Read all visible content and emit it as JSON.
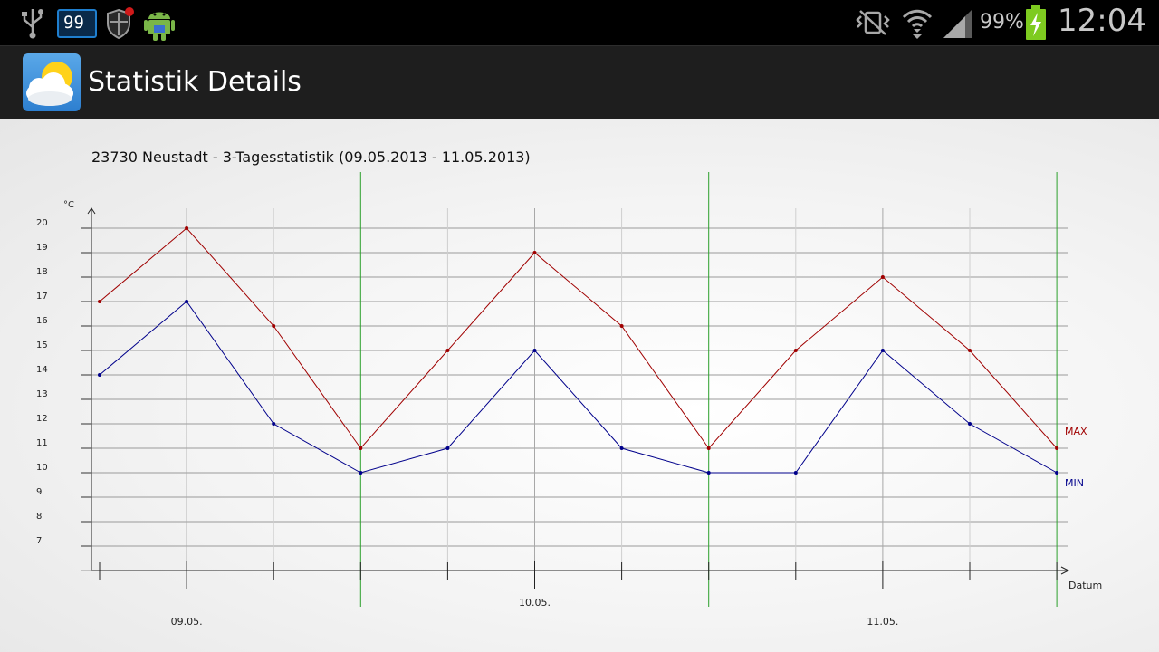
{
  "status_bar": {
    "notification_count": "99",
    "battery_percent": "99%",
    "clock": "12:04",
    "icons": [
      "usb-icon",
      "notification-count-icon",
      "shield-icon",
      "android-icon",
      "vibrate-off-icon",
      "wifi-icon",
      "signal-icon",
      "battery-charging-icon"
    ]
  },
  "action_bar": {
    "title": "Statistik Details",
    "app_icon": "weather-icon"
  },
  "chart_data": {
    "type": "line",
    "title": "23730 Neustadt - 3-Tagesstatistik (09.05.2013 - 11.05.2013)",
    "ylabel": "°C",
    "xlabel": "Datum",
    "ylim": [
      7,
      20
    ],
    "yticks": [
      "20",
      "19",
      "18",
      "17",
      "16",
      "15",
      "14",
      "13",
      "12",
      "11",
      "10",
      "9",
      "8",
      "7"
    ],
    "x_points": 12,
    "day_labels": [
      "09.05.",
      "10.05.",
      "11.05."
    ],
    "series": [
      {
        "name": "MAX",
        "color": "#a00000",
        "values": [
          17,
          20,
          16,
          11,
          15,
          19,
          16,
          11,
          15,
          18,
          15,
          11
        ]
      },
      {
        "name": "MIN",
        "color": "#00008b",
        "values": [
          14,
          17,
          12,
          10,
          11,
          15,
          11,
          10,
          10,
          15,
          12,
          10
        ]
      }
    ],
    "grid": true,
    "day_separator_color": "#2ca02c"
  }
}
